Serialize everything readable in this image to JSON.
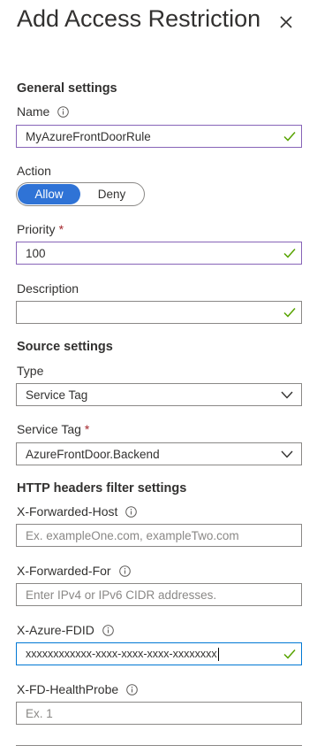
{
  "panel": {
    "title": "Add Access Restriction"
  },
  "general": {
    "heading": "General settings",
    "name_label": "Name",
    "name_value": "MyAzureFrontDoorRule",
    "action_label": "Action",
    "action_options": [
      "Allow",
      "Deny"
    ],
    "action_selected": "Allow",
    "priority_label": "Priority",
    "priority_value": "100",
    "description_label": "Description",
    "description_value": ""
  },
  "source": {
    "heading": "Source settings",
    "type_label": "Type",
    "type_value": "Service Tag",
    "service_tag_label": "Service Tag",
    "service_tag_value": "AzureFrontDoor.Backend"
  },
  "http_headers": {
    "heading": "HTTP headers filter settings",
    "x_forwarded_host_label": "X-Forwarded-Host",
    "x_forwarded_host_placeholder": "Ex. exampleOne.com, exampleTwo.com",
    "x_forwarded_for_label": "X-Forwarded-For",
    "x_forwarded_for_placeholder": "Enter IPv4 or IPv6 CIDR addresses.",
    "x_azure_fdid_label": "X-Azure-FDID",
    "x_azure_fdid_value": "xxxxxxxxxxxx-xxxx-xxxx-xxxx-xxxxxxxx",
    "x_fd_healthprobe_label": "X-FD-HealthProbe",
    "x_fd_healthprobe_placeholder": "Ex. 1"
  },
  "required_marker": "*",
  "colors": {
    "accent": "#2f73d6",
    "valid_check": "#57a300",
    "focus_border": "#8764b8",
    "active_border": "#0078d4",
    "required": "#a4262c"
  },
  "icons": [
    "close-icon",
    "info-icon",
    "checkmark-icon",
    "chevron-down-icon"
  ]
}
